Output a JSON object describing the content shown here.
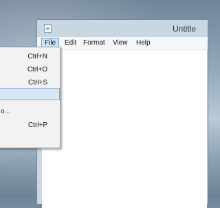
{
  "window": {
    "title": "Untitle"
  },
  "menubar": {
    "items": [
      {
        "label": "File"
      },
      {
        "label": "Edit"
      },
      {
        "label": "Format"
      },
      {
        "label": "View"
      },
      {
        "label": "Help"
      }
    ]
  },
  "file_menu": {
    "items": [
      {
        "label": "",
        "shortcut": "Ctrl+N"
      },
      {
        "label": "",
        "shortcut": "Ctrl+O"
      },
      {
        "label": "",
        "shortcut": "Ctrl+S"
      },
      {
        "label": "",
        "shortcut": ""
      },
      {
        "label": "o...",
        "shortcut": ""
      },
      {
        "label": "",
        "shortcut": "Ctrl+P"
      }
    ]
  },
  "icons": {
    "app": "notepad-icon"
  },
  "colors": {
    "menu_highlight": "#cfe3f5",
    "menu_highlight_border": "#66a0d6"
  }
}
